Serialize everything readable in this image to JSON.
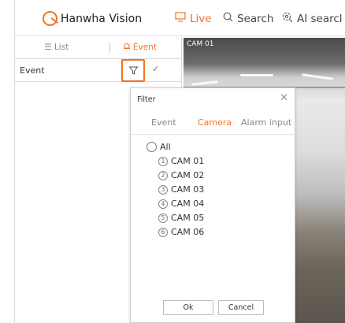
{
  "header": {
    "logo_text": "Hanwha Vision",
    "nav": [
      {
        "label": "Live",
        "icon": "monitor-icon",
        "active": true
      },
      {
        "label": "Search",
        "icon": "search-icon",
        "active": false
      },
      {
        "label": "AI searcl",
        "icon": "ai-search-icon",
        "active": false
      }
    ]
  },
  "sidebar": {
    "tabs": [
      {
        "label": "List",
        "icon": "list-icon",
        "active": false
      },
      {
        "label": "Event",
        "icon": "bell-icon",
        "active": true
      }
    ],
    "event_label": "Event"
  },
  "camera": {
    "title": "CAM 01"
  },
  "filter_dialog": {
    "title": "Filter",
    "tabs": [
      {
        "label": "Event",
        "active": false
      },
      {
        "label": "Camera",
        "active": true
      },
      {
        "label": "Alarm input",
        "active": false
      }
    ],
    "all_label": "All",
    "options": [
      {
        "num": "1",
        "label": "CAM 01"
      },
      {
        "num": "2",
        "label": "CAM 02"
      },
      {
        "num": "3",
        "label": "CAM 03"
      },
      {
        "num": "4",
        "label": "CAM 04"
      },
      {
        "num": "5",
        "label": "CAM 05"
      },
      {
        "num": "6",
        "label": "CAM 06"
      }
    ],
    "ok_label": "Ok",
    "cancel_label": "Cancel"
  },
  "colors": {
    "accent": "#f37321"
  }
}
